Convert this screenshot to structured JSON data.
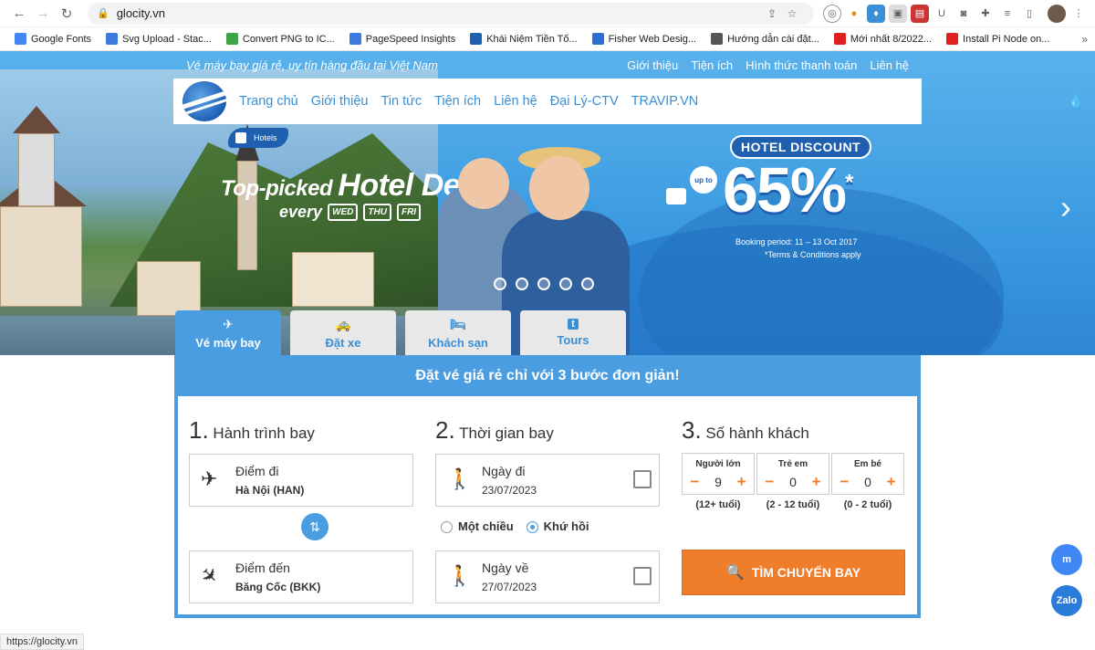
{
  "browser": {
    "url": "glocity.vn",
    "status_url": "https://glocity.vn",
    "bookmarks": [
      {
        "label": "Google Fonts",
        "color": "#4285f4"
      },
      {
        "label": "Svg Upload - Stac...",
        "color": "#3d7ae0"
      },
      {
        "label": "Convert PNG to IC...",
        "color": "#3ca346"
      },
      {
        "label": "PageSpeed Insights",
        "color": "#3d7ae0"
      },
      {
        "label": "Khái Niệm Tiền Tố...",
        "color": "#1e5fb0"
      },
      {
        "label": "Fisher Web Desig...",
        "color": "#2c6fd1"
      },
      {
        "label": "Hướng dẫn cài đặt...",
        "color": "#555555"
      },
      {
        "label": "Mới nhất 8/2022...",
        "color": "#e02020"
      },
      {
        "label": "Install Pi Node on...",
        "color": "#e02020"
      }
    ],
    "more": "»"
  },
  "site": {
    "slogan": "Vé máy bay giá rẻ, uy tín hàng đầu tại Việt Nam",
    "top_links": [
      "Giới thiệu",
      "Tiện ích",
      "Hình thức thanh toán",
      "Liên hệ"
    ],
    "nav": [
      "Trang chủ",
      "Giới thiệu",
      "Tin tức",
      "Tiện ích",
      "Liên hệ",
      "Đại Lý-CTV",
      "TRAVIP.VN"
    ]
  },
  "banner": {
    "badge": "Hotels",
    "title_a": "Top-picked ",
    "title_b": "Hotel Deals",
    "every": "every",
    "days": [
      "WED",
      "THU",
      "FRI"
    ],
    "discount_label": "HOTEL DISCOUNT",
    "up_to": "up to",
    "percent": "65%",
    "asterisk": "*",
    "booking_period": "Booking period: 11 – 13 Oct 2017",
    "terms": "*Terms & Conditions apply"
  },
  "tabs": [
    {
      "label": "Vé máy bay",
      "icon": "✈",
      "active": true
    },
    {
      "label": "Đặt xe",
      "icon": "🚕",
      "active": false
    },
    {
      "label": "Khách sạn",
      "icon": "🛏",
      "active": false
    },
    {
      "label": "Tours",
      "icon": "t",
      "active": false
    }
  ],
  "booking": {
    "headline": "Đặt vé giá rẻ chỉ với 3 bước đơn giản!",
    "step1": {
      "num": "1.",
      "title": " Hành trình bay"
    },
    "step2": {
      "num": "2.",
      "title": " Thời gian bay"
    },
    "step3": {
      "num": "3.",
      "title": " Số hành khách"
    },
    "from": {
      "label": "Điểm đi",
      "value": "Hà Nội (HAN)"
    },
    "to": {
      "label": "Điểm đến",
      "value": "Băng Cốc (BKK)"
    },
    "depart": {
      "label": "Ngày đi",
      "value": "23/07/2023"
    },
    "return": {
      "label": "Ngày về",
      "value": "27/07/2023"
    },
    "trip_types": [
      "Một chiều",
      "Khứ hồi"
    ],
    "trip_selected": "Khứ hồi",
    "passengers": [
      {
        "label": "Người lớn",
        "count": "9",
        "age": "(12+ tuổi)"
      },
      {
        "label": "Trẻ em",
        "count": "0",
        "age": "(2 - 12 tuổi)"
      },
      {
        "label": "Em bé",
        "count": "0",
        "age": "(0 - 2 tuổi)"
      }
    ],
    "search_label": "TÌM CHUYẾN BAY",
    "minus": "−",
    "plus": "+"
  },
  "float": {
    "messenger": "m",
    "zalo": "Zalo"
  }
}
